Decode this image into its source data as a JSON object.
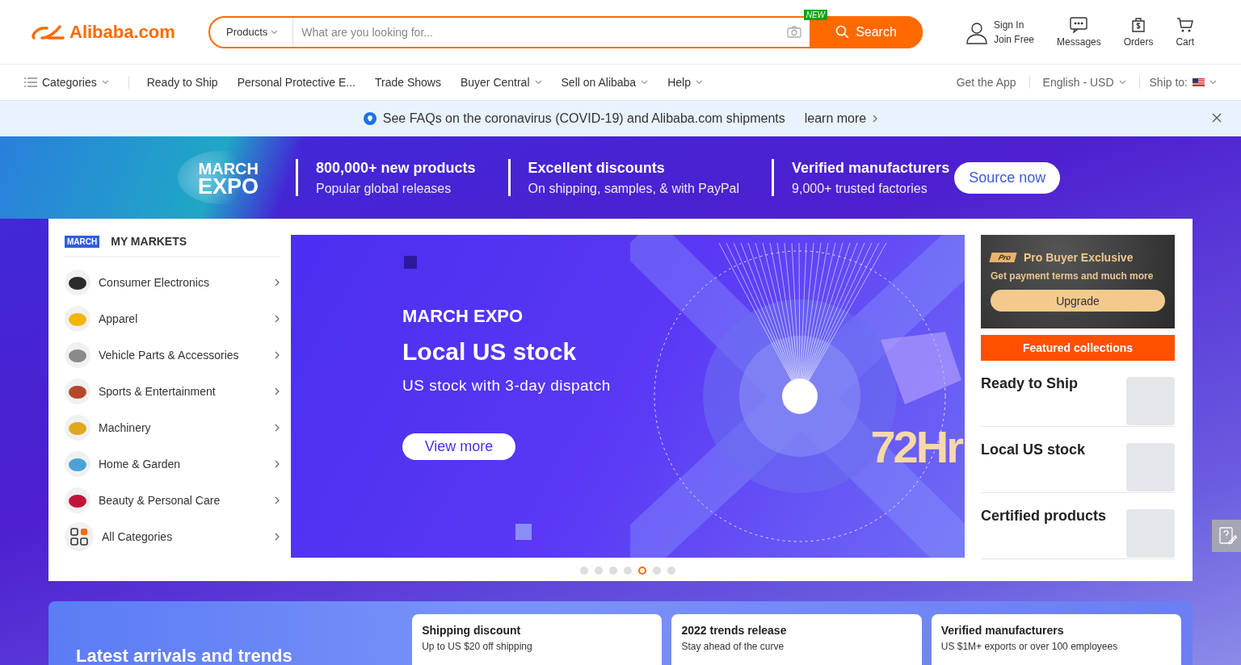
{
  "header": {
    "logo": "Alibaba.com",
    "search": {
      "category": "Products",
      "placeholder": "What are you looking for...",
      "badge": "NEW",
      "button": "Search"
    },
    "account": {
      "sign_in": "Sign In",
      "join": "Join Free"
    },
    "actions": [
      {
        "kind": "messages",
        "label": "Messages"
      },
      {
        "kind": "orders",
        "label": "Orders"
      },
      {
        "kind": "cart",
        "label": "Cart"
      }
    ]
  },
  "nav": {
    "categories": "Categories",
    "items": [
      {
        "label": "Ready to Ship",
        "dropdown": false
      },
      {
        "label": "Personal Protective E...",
        "dropdown": false
      },
      {
        "label": "Trade Shows",
        "dropdown": false
      },
      {
        "label": "Buyer Central",
        "dropdown": true
      },
      {
        "label": "Sell on Alibaba",
        "dropdown": true
      },
      {
        "label": "Help",
        "dropdown": true
      }
    ],
    "app": "Get the App",
    "language": "English - USD",
    "ship_to": "Ship to:"
  },
  "notice": {
    "text": "See FAQs on the coronavirus (COVID-19) and Alibaba.com shipments",
    "link": "learn more"
  },
  "expo": {
    "logo": [
      "MARCH",
      "EXPO"
    ],
    "features": [
      {
        "title": "800,000+ new products",
        "subtitle": "Popular global releases"
      },
      {
        "title": "Excellent discounts",
        "subtitle": "On shipping, samples, & with PayPal"
      },
      {
        "title": "Verified manufacturers",
        "subtitle": "9,000+ trusted factories"
      }
    ],
    "button": "Source now"
  },
  "markets": {
    "badge": "MARCH",
    "title": "MY MARKETS",
    "items": [
      {
        "label": "Consumer Electronics",
        "kind": "photo",
        "color": "#2b2b2b"
      },
      {
        "label": "Apparel",
        "kind": "photo",
        "color": "#f2b705"
      },
      {
        "label": "Vehicle Parts & Accessories",
        "kind": "photo",
        "color": "#8a8a8a"
      },
      {
        "label": "Sports & Entertainment",
        "kind": "photo",
        "color": "#b5482a"
      },
      {
        "label": "Machinery",
        "kind": "photo",
        "color": "#e0a81c"
      },
      {
        "label": "Home & Garden",
        "kind": "photo",
        "color": "#4aa3d8"
      },
      {
        "label": "Beauty & Personal Care",
        "kind": "photo",
        "color": "#c0153a"
      },
      {
        "label": "All Categories",
        "kind": "grid",
        "color": "#ff6a00"
      }
    ]
  },
  "slide": {
    "logo": "MARCH EXPO",
    "title": "Local US stock",
    "subtitle": "US stock with 3-day dispatch",
    "button": "View more",
    "badge": "72Hr"
  },
  "dots": [
    {
      "selected": false
    },
    {
      "selected": false
    },
    {
      "selected": false
    },
    {
      "selected": false
    },
    {
      "selected": true
    },
    {
      "selected": false
    },
    {
      "selected": false
    }
  ],
  "pro": {
    "badge": "Pro",
    "title": "Pro Buyer Exclusive",
    "subtitle": "Get payment terms and much more",
    "button": "Upgrade"
  },
  "featured": {
    "title": "Featured collections",
    "items": [
      {
        "label": "Ready to Ship"
      },
      {
        "label": "Local US stock"
      },
      {
        "label": "Certified products"
      }
    ]
  },
  "bottom": {
    "title": "Latest arrivals and trends",
    "cards": [
      {
        "title": "Shipping discount",
        "subtitle": "Up to US $20 off shipping"
      },
      {
        "title": "2022 trends release",
        "subtitle": "Stay ahead of the curve"
      },
      {
        "title": "Verified manufacturers",
        "subtitle": "US $1M+ exports or over 100 employees"
      }
    ]
  }
}
